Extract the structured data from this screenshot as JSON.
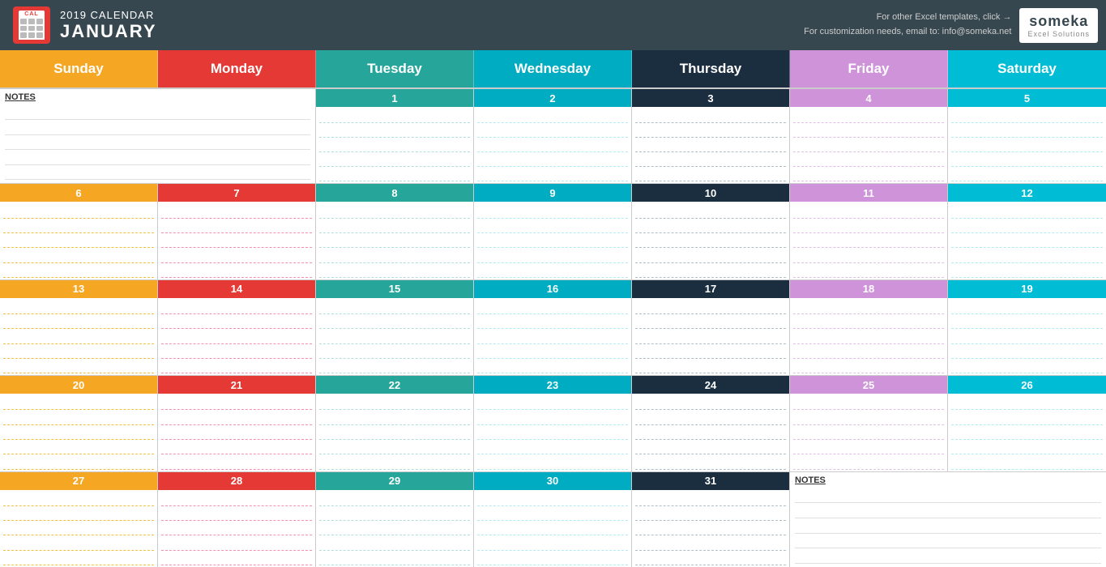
{
  "header": {
    "year": "2019",
    "title": "2019 CALENDAR",
    "month": "JANUARY",
    "links_line1": "For other Excel templates, click →",
    "links_line2": "For customization needs, email to: info@someka.net",
    "logo_text": "someka",
    "logo_sub": "Excel Solutions"
  },
  "days": {
    "sunday": "Sunday",
    "monday": "Monday",
    "tuesday": "Tuesday",
    "wednesday": "Wednesday",
    "thursday": "Thursday",
    "friday": "Friday",
    "saturday": "Saturday"
  },
  "notes_label": "NOTES",
  "calendar": {
    "rows": [
      {
        "cells": [
          {
            "type": "notes"
          },
          {
            "type": "empty"
          },
          {
            "type": "day",
            "num": "1",
            "dow": "tuesday"
          },
          {
            "type": "day",
            "num": "2",
            "dow": "wednesday"
          },
          {
            "type": "day",
            "num": "3",
            "dow": "thursday"
          },
          {
            "type": "day",
            "num": "4",
            "dow": "friday"
          },
          {
            "type": "day",
            "num": "5",
            "dow": "saturday"
          }
        ]
      },
      {
        "cells": [
          {
            "type": "day",
            "num": "6",
            "dow": "sunday"
          },
          {
            "type": "day",
            "num": "7",
            "dow": "monday"
          },
          {
            "type": "day",
            "num": "8",
            "dow": "tuesday"
          },
          {
            "type": "day",
            "num": "9",
            "dow": "wednesday"
          },
          {
            "type": "day",
            "num": "10",
            "dow": "thursday"
          },
          {
            "type": "day",
            "num": "11",
            "dow": "friday"
          },
          {
            "type": "day",
            "num": "12",
            "dow": "saturday"
          }
        ]
      },
      {
        "cells": [
          {
            "type": "day",
            "num": "13",
            "dow": "sunday"
          },
          {
            "type": "day",
            "num": "14",
            "dow": "monday"
          },
          {
            "type": "day",
            "num": "15",
            "dow": "tuesday"
          },
          {
            "type": "day",
            "num": "16",
            "dow": "wednesday"
          },
          {
            "type": "day",
            "num": "17",
            "dow": "thursday"
          },
          {
            "type": "day",
            "num": "18",
            "dow": "friday"
          },
          {
            "type": "day",
            "num": "19",
            "dow": "saturday"
          }
        ]
      },
      {
        "cells": [
          {
            "type": "day",
            "num": "20",
            "dow": "sunday"
          },
          {
            "type": "day",
            "num": "21",
            "dow": "monday"
          },
          {
            "type": "day",
            "num": "22",
            "dow": "tuesday"
          },
          {
            "type": "day",
            "num": "23",
            "dow": "wednesday"
          },
          {
            "type": "day",
            "num": "24",
            "dow": "thursday"
          },
          {
            "type": "day",
            "num": "25",
            "dow": "friday"
          },
          {
            "type": "day",
            "num": "26",
            "dow": "saturday"
          }
        ]
      },
      {
        "cells": [
          {
            "type": "day",
            "num": "27",
            "dow": "sunday"
          },
          {
            "type": "day",
            "num": "28",
            "dow": "monday"
          },
          {
            "type": "day",
            "num": "29",
            "dow": "tuesday"
          },
          {
            "type": "day",
            "num": "30",
            "dow": "wednesday"
          },
          {
            "type": "day",
            "num": "31",
            "dow": "thursday"
          },
          {
            "type": "notes_last",
            "span": 2
          }
        ]
      }
    ],
    "line_count": 5
  }
}
